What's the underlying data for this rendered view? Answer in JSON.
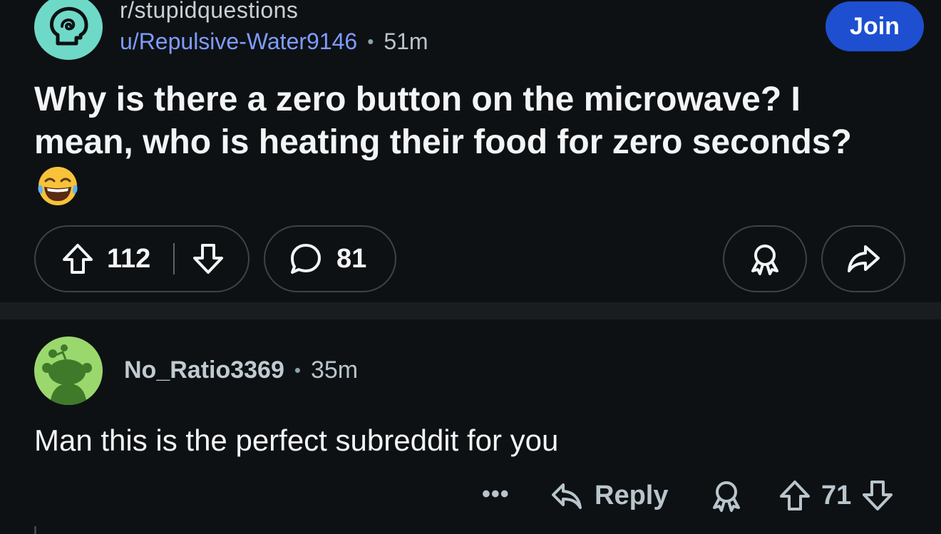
{
  "post": {
    "subreddit": "r/stupidquestions",
    "author": "u/Repulsive-Water9146",
    "separator": "•",
    "time": "51m",
    "join_label": "Join",
    "title": "Why is there a zero button on the microwave? I mean, who is heating their food for zero seconds?",
    "emoji": "face-with-tears-of-joy",
    "upvotes": "112",
    "comments": "81"
  },
  "comment": {
    "author": "No_Ratio3369",
    "separator": "•",
    "time": "35m",
    "body": "Man this is the perfect subreddit for you",
    "more_label": "•••",
    "reply_label": "Reply",
    "score": "71"
  },
  "colors": {
    "background": "#0e1113",
    "divider": "#1a1d20",
    "join_button": "#1d4fd0",
    "username_link": "#7e9cff",
    "subreddit_avatar": "#6fd9c8",
    "comment_avatar": "#9ad86d"
  }
}
